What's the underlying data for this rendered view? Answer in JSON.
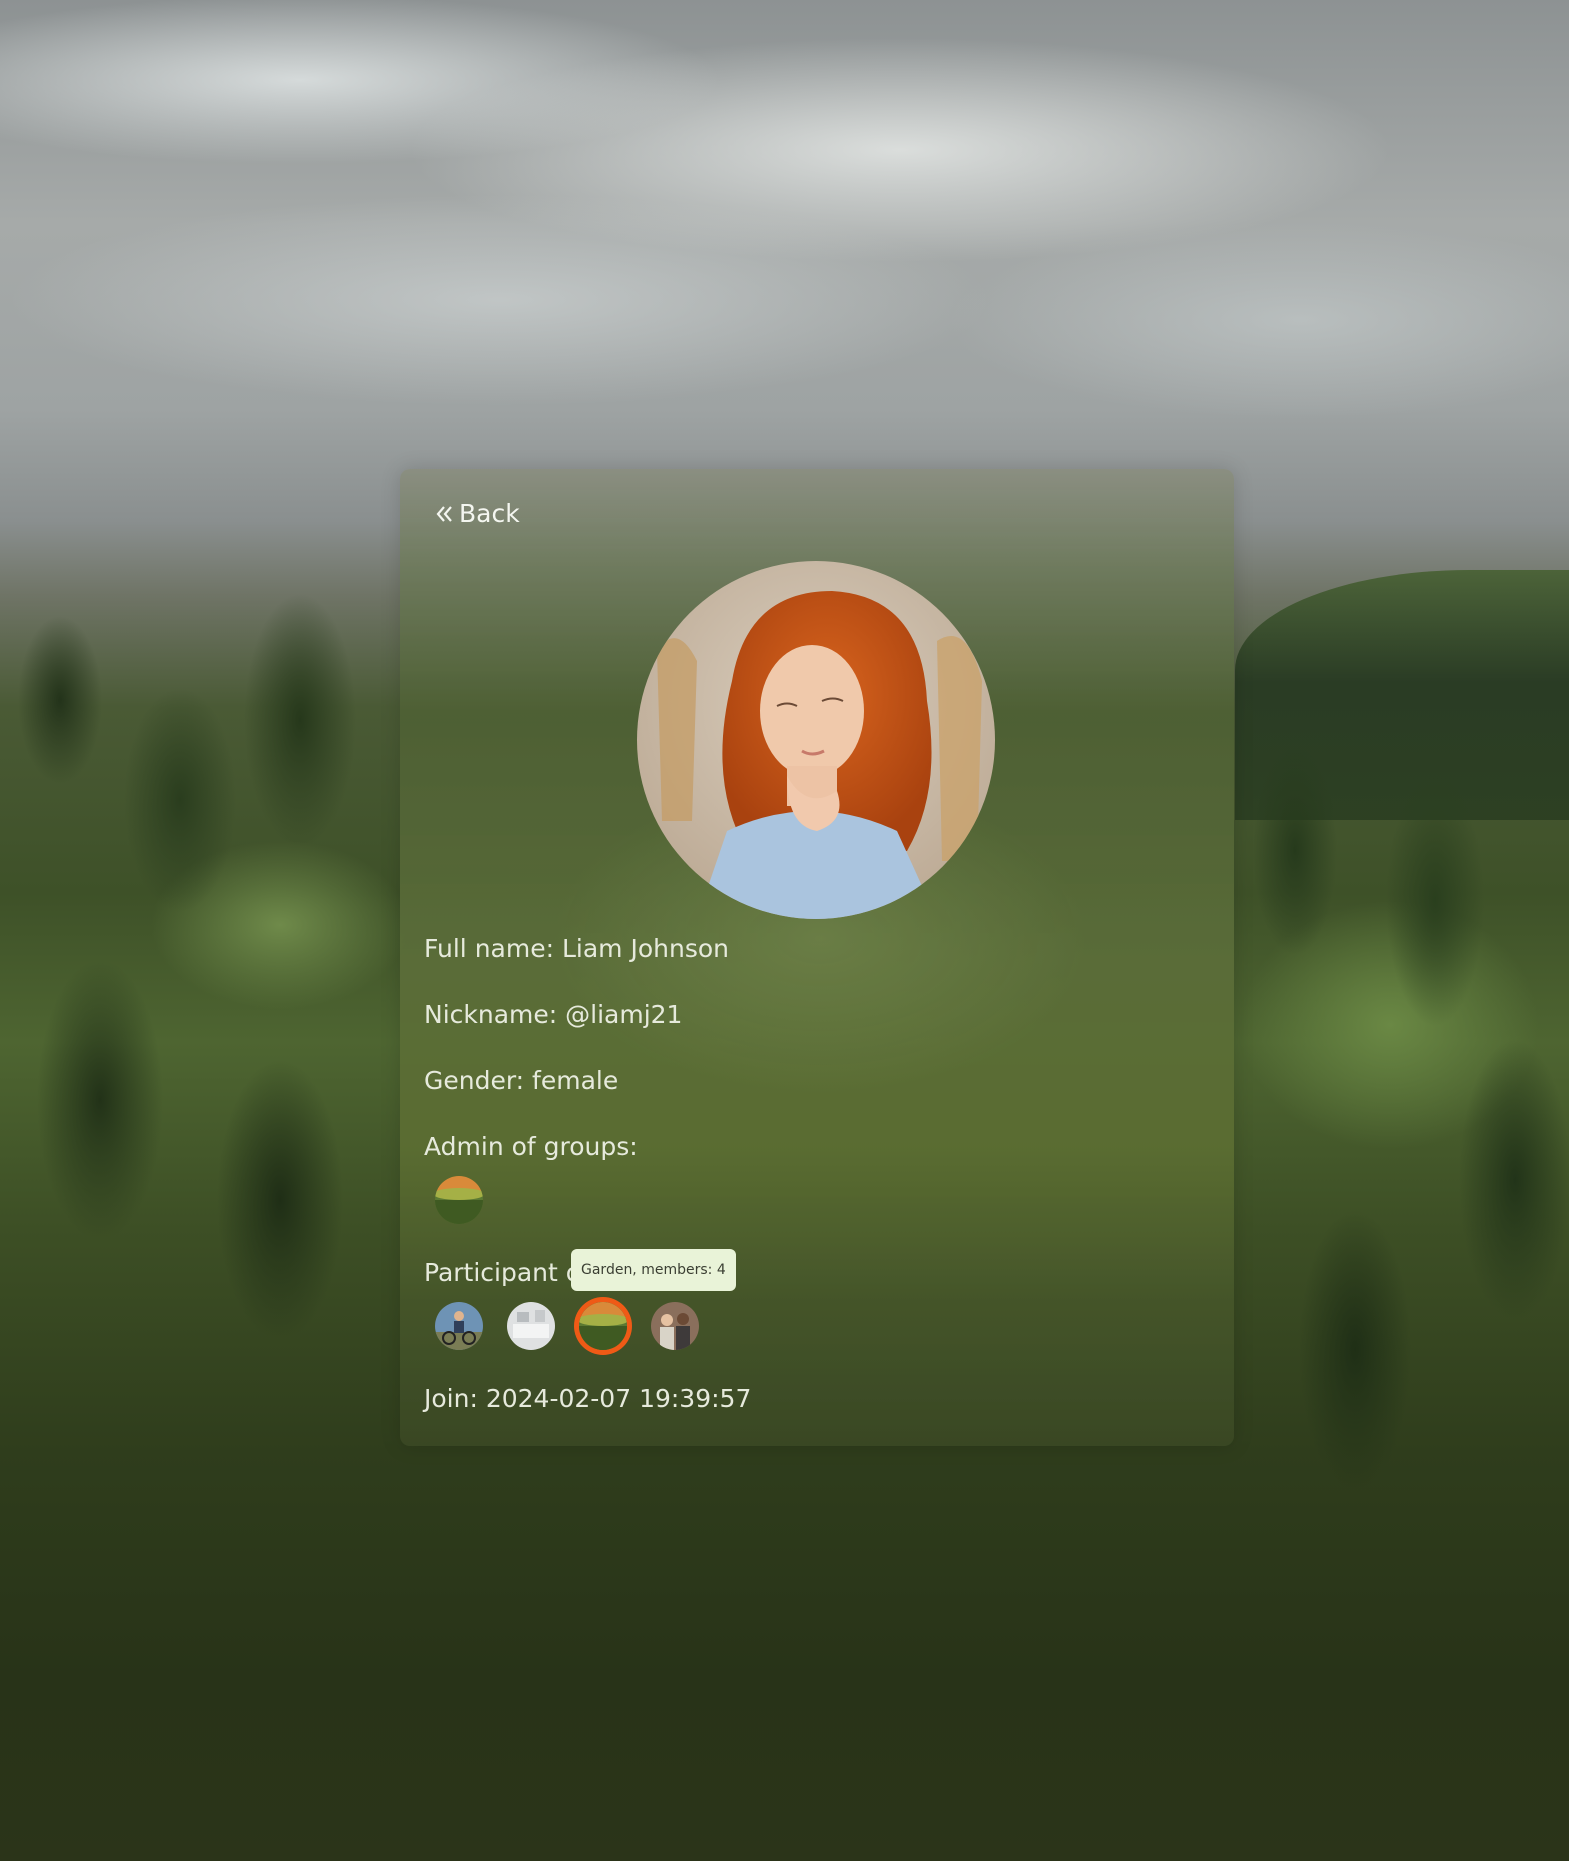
{
  "nav": {
    "back_label": "Back"
  },
  "profile": {
    "full_name_label": "Full name: Liam Johnson",
    "nickname_label": "Nickname: @liamj21",
    "gender_label": "Gender: female",
    "admin_groups_label": "Admin of groups:",
    "participant_groups_label": "Participant of groups:",
    "join_label": "Join: 2024-02-07 19:39:57"
  },
  "admin_groups": [
    {
      "icon": "garden-group-avatar"
    }
  ],
  "participant_groups": [
    {
      "icon": "cycling-group-avatar"
    },
    {
      "icon": "interior-group-avatar"
    },
    {
      "icon": "garden-group-avatar",
      "active": true
    },
    {
      "icon": "people-group-avatar"
    }
  ],
  "tooltip": {
    "text": "Garden, members: 4"
  },
  "colors": {
    "active_ring": "#ef5a16",
    "tooltip_bg": "#e9f3d8"
  }
}
